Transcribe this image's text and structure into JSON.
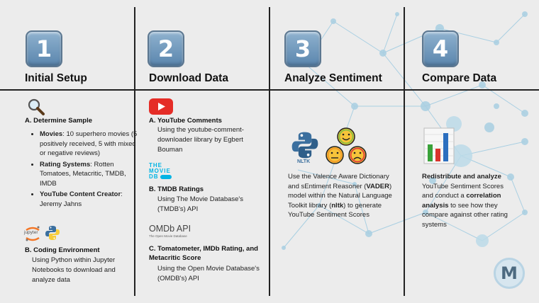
{
  "steps": [
    {
      "number": "1",
      "title": "Initial Setup",
      "sample_heading": "A. Determine Sample",
      "bullets": [
        {
          "label": "Movies",
          "text": ": 10 superhero movies (5 positively received, 5 with mixed or negative reviews)"
        },
        {
          "label": "Rating Systems",
          "text": ": Rotten Tomatoes, Metacritic, TMDB, IMDB"
        },
        {
          "label": "YouTube Content Creator",
          "text": ": Jeremy Jahns"
        }
      ],
      "env_heading": "B. Coding Environment",
      "env_text": "Using Python within Jupyter Notebooks to download and analyze data",
      "jupyter_label": "jupyter"
    },
    {
      "number": "2",
      "title": "Download Data",
      "yt_heading": "A. YouTube Comments",
      "yt_text": "Using the youtube-comment-downloader library by Egbert Bouman",
      "tmdb_logo": [
        "THE",
        "MOVIE",
        "DB"
      ],
      "tmdb_heading": "B. TMDB Ratings",
      "tmdb_text": "Using The Movie Database's (TMDB's) API",
      "omdb_logo": "OMDb API",
      "omdb_tagline": "The Open Movie Database",
      "omdb_heading": "C. Tomatometer, IMDb Rating, and Metacritic Score",
      "omdb_text": "Using the Open Movie Database's (OMDB's) API"
    },
    {
      "number": "3",
      "title": "Analyze Sentiment",
      "nltk_label": "NLTK",
      "text_before_vader": "Use the Valence Aware Dictionary and sEntiment Reasoner (",
      "vader": "VADER",
      "text_middle": ") model within the Natural Language Toolkit library (",
      "nltk": "nltk",
      "text_end": ") to generate YouTube Sentiment Scores"
    },
    {
      "number": "4",
      "title": "Compare Data",
      "lead_bold": "Redistribute and analyze",
      "text_mid": " YouTube Sentiment Scores and conduct a ",
      "corr_bold": "correlation analysis",
      "text_end": " to see how they compare against other rating systems"
    }
  ],
  "logo_letter": "M",
  "colors": {
    "badge": "#6f97bd",
    "youtube": "#e52d27",
    "tmdb": "#01b4e4",
    "python_blue": "#3b6f9e",
    "python_yellow": "#f7cc3a",
    "network": "#a9cfe2"
  }
}
